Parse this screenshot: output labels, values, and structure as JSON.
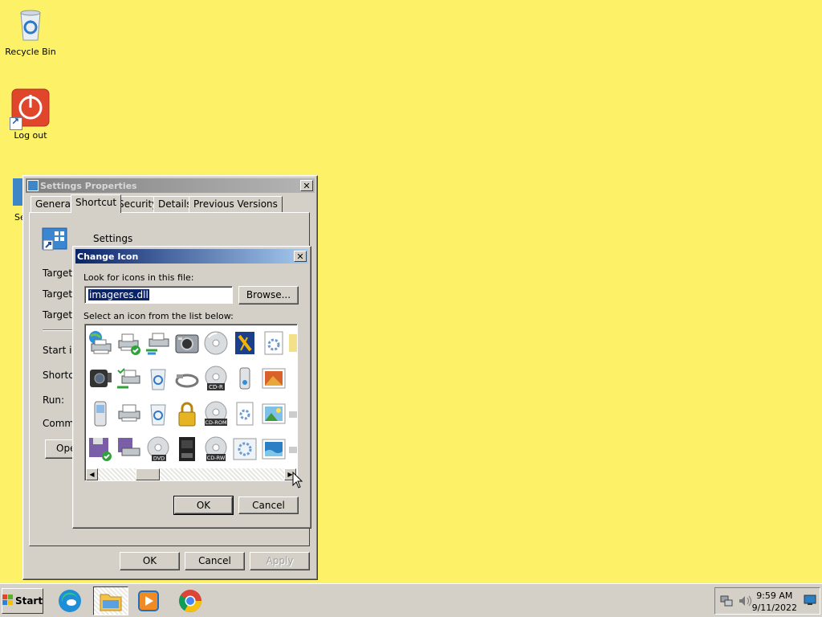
{
  "desktop": {
    "icons": [
      {
        "label": "Recycle Bin"
      },
      {
        "label": "Log out"
      },
      {
        "label": "Se"
      }
    ]
  },
  "settings_window": {
    "title": "Settings Properties",
    "tabs": [
      "General",
      "Shortcut",
      "Security",
      "Details",
      "Previous Versions"
    ],
    "active_tab": "Shortcut",
    "shortcut_name": "Settings",
    "fields": [
      "Target ty",
      "Target lo",
      "Target:",
      "Start in:",
      "Shortcut",
      "Run:",
      "Commen"
    ],
    "open_button": "Open",
    "ok": "OK",
    "cancel": "Cancel",
    "apply": "Apply"
  },
  "change_icon_dialog": {
    "title": "Change Icon",
    "look_label": "Look for icons in this file:",
    "file_value": "imageres.dll",
    "browse": "Browse...",
    "list_label": "Select an icon from the list below:",
    "ok": "OK",
    "cancel": "Cancel",
    "icon_badges": {
      "cdr": "CD-R",
      "cdrom": "CD-ROM",
      "dvd": "DVD",
      "cdrw": "CD-RW"
    }
  },
  "taskbar": {
    "start": "Start",
    "apps": [
      "edge-icon",
      "file-explorer-icon",
      "media-player-icon",
      "chrome-icon"
    ],
    "clock_time": "9:59 AM",
    "clock_date": "9/11/2022"
  }
}
